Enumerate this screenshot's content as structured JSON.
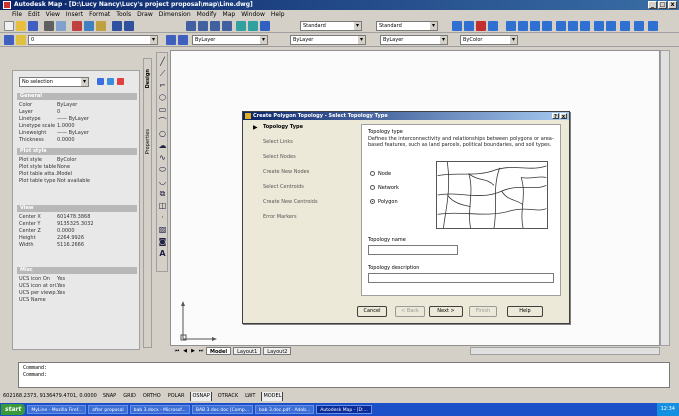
{
  "window": {
    "title": "Autodesk Map - [D:\\Lucy Nancy\\Lucy's project proposal\\map\\Line.dwg]",
    "controls": [
      "_",
      "□",
      "x"
    ]
  },
  "menubar": {
    "items": [
      "File",
      "Edit",
      "View",
      "Insert",
      "Format",
      "Tools",
      "Draw",
      "Dimension",
      "Modify",
      "Map",
      "Window",
      "Help"
    ]
  },
  "toolbars": {
    "layer_combo": "0",
    "color_combo": "ByLayer",
    "linetype_combo": "ByLayer",
    "lineweight_combo": "ByLayer",
    "plotstyle_combo": "ByColor",
    "standard_combo": "Standard",
    "dimstyle_combo": "Standard"
  },
  "properties": {
    "selection": "No selection",
    "sections": [
      {
        "title": "General",
        "rows": [
          {
            "label": "Color",
            "value": "ByLayer"
          },
          {
            "label": "Layer",
            "value": "0"
          },
          {
            "label": "Linetype",
            "value": "—— ByLayer"
          },
          {
            "label": "Linetype scale",
            "value": "1.0000"
          },
          {
            "label": "Lineweight",
            "value": "—— ByLayer"
          },
          {
            "label": "Thickness",
            "value": "0.0000"
          }
        ]
      },
      {
        "title": "Plot style",
        "rows": [
          {
            "label": "Plot style",
            "value": "ByColor"
          },
          {
            "label": "Plot style table",
            "value": "None"
          },
          {
            "label": "Plot table atta...",
            "value": "Model"
          },
          {
            "label": "Plot table type",
            "value": "Not available"
          }
        ]
      },
      {
        "title": "View",
        "rows": [
          {
            "label": "Center X",
            "value": "601478.3868"
          },
          {
            "label": "Center Y",
            "value": "9135325.3032"
          },
          {
            "label": "Center Z",
            "value": "0.0000"
          },
          {
            "label": "Height",
            "value": "2264.9926"
          },
          {
            "label": "Width",
            "value": "5116.2666"
          }
        ]
      },
      {
        "title": "Misc",
        "rows": [
          {
            "label": "UCS icon On",
            "value": "Yes"
          },
          {
            "label": "UCS icon at ori...",
            "value": "Yes"
          },
          {
            "label": "UCS per viewp...",
            "value": "Yes"
          },
          {
            "label": "UCS Name",
            "value": ""
          }
        ]
      }
    ],
    "side_tabs": [
      "Design",
      "Properties",
      "Alphabetic"
    ]
  },
  "layout_tabs": [
    "Model",
    "Layout1",
    "Layout2"
  ],
  "command_lines": [
    "Command:",
    "Command:"
  ],
  "status": {
    "coordinates": "602168.2373, 9136479.4701, 0.0000",
    "toggles": [
      {
        "label": "SNAP",
        "on": false
      },
      {
        "label": "GRID",
        "on": false
      },
      {
        "label": "ORTHO",
        "on": false
      },
      {
        "label": "POLAR",
        "on": false
      },
      {
        "label": "OSNAP",
        "on": true
      },
      {
        "label": "OTRACK",
        "on": false
      },
      {
        "label": "LWT",
        "on": false
      },
      {
        "label": "MODEL",
        "on": true
      }
    ]
  },
  "taskbar": {
    "start": "start",
    "items": [
      "MyLine - Mozilla Firef...",
      "after proposal",
      "bab 3.docx - Microsof...",
      "BAB 3.doc.doc [Comp...",
      "bab 3.doc.pdf - Adob...",
      "Autodesk Map - [D:..."
    ],
    "active_index": 5,
    "clock": "12:34"
  },
  "dialog": {
    "title": "Create Polygon Topology - Select Topology Type",
    "title_controls": [
      "?",
      "x"
    ],
    "steps": [
      "Topology Type",
      "Select Links",
      "Select Nodes",
      "Create New Nodes",
      "Select Centroids",
      "Create New Centroids",
      "Error Markers"
    ],
    "active_step": 0,
    "heading": "Topology type",
    "description": "Defines the interconnectivity and relationships between polygons or area-based features, such as land parcels, political boundaries, and soil types.",
    "options": [
      {
        "label": "Node",
        "selected": false
      },
      {
        "label": "Network",
        "selected": false
      },
      {
        "label": "Polygon",
        "selected": true
      }
    ],
    "name_label": "Topology name",
    "name_value": "",
    "description_label": "Topology description",
    "description_value": "",
    "buttons": [
      {
        "label": "Cancel",
        "enabled": true
      },
      {
        "label": "< Back",
        "enabled": false
      },
      {
        "label": "Next >",
        "enabled": true
      },
      {
        "label": "Finish",
        "enabled": false
      },
      {
        "label": "Help",
        "enabled": true
      }
    ]
  },
  "colors": {
    "title_bar": "#0a246a",
    "dialog_face": "#ece9d8",
    "taskbar": "#1c50c8",
    "start_button": "#3a9a3a"
  }
}
